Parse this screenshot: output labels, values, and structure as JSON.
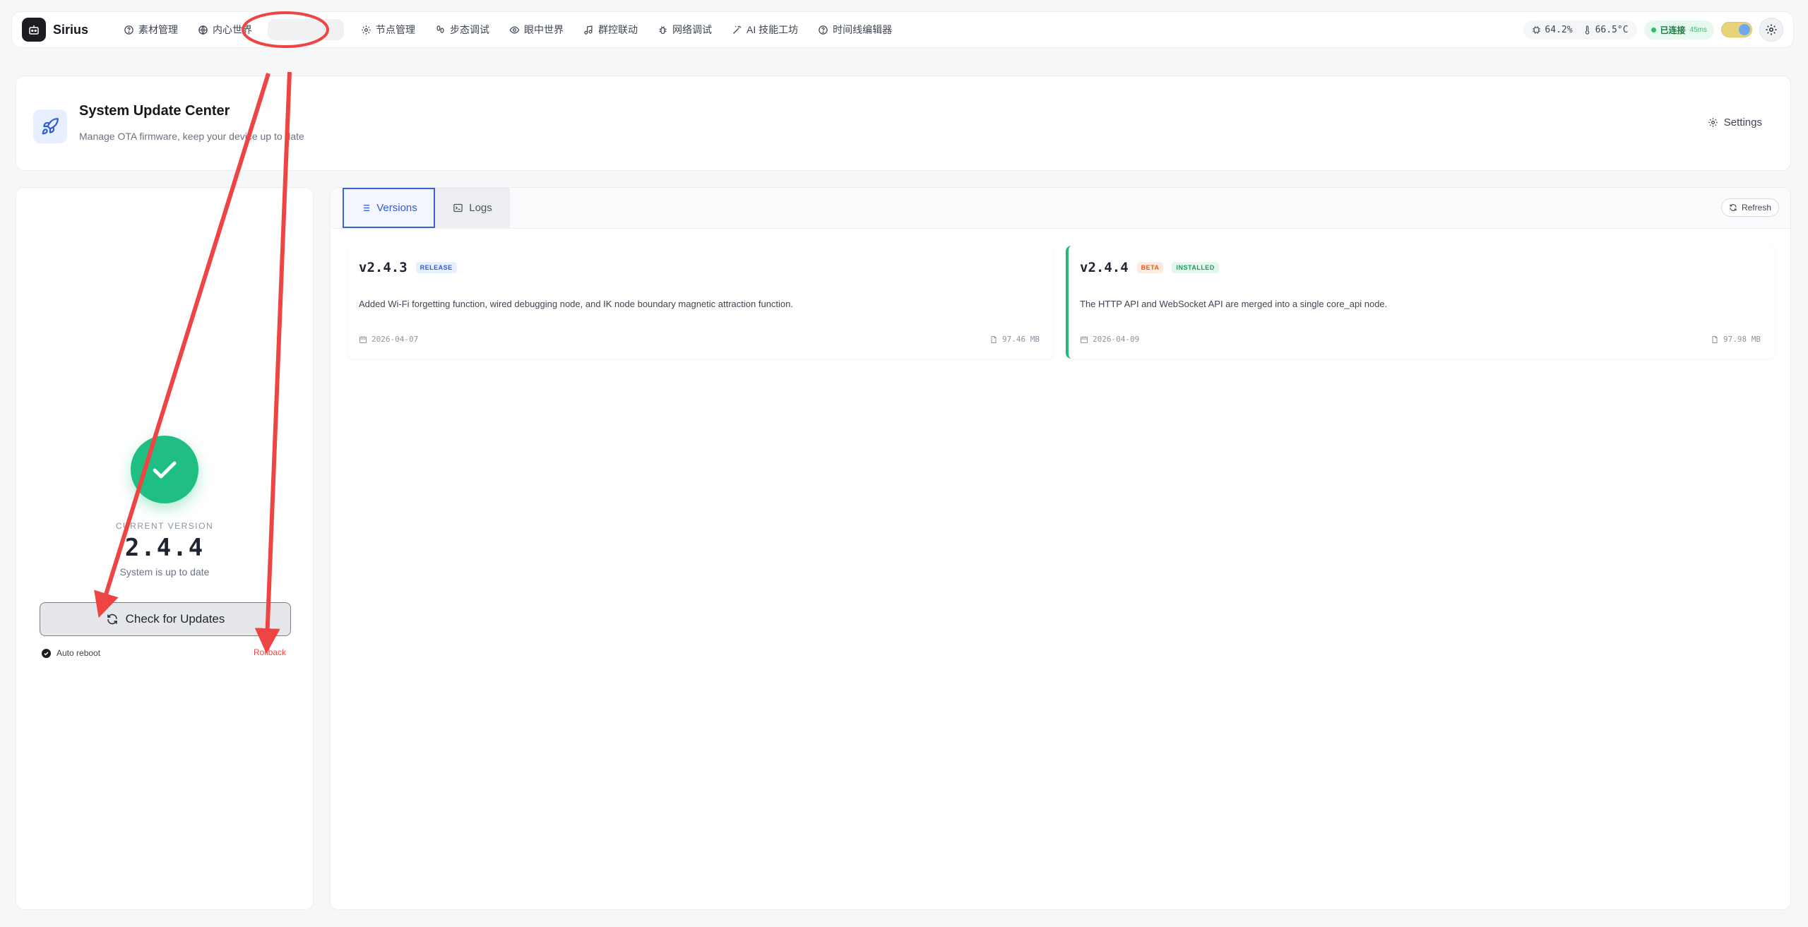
{
  "brand": {
    "name": "Sirius"
  },
  "nav": {
    "items": [
      {
        "label": "素材管理",
        "icon": "help-circle-icon"
      },
      {
        "label": "内心世界",
        "icon": "globe-icon"
      },
      {
        "label": "",
        "icon": ""
      },
      {
        "label": "节点管理",
        "icon": "gear-icon"
      },
      {
        "label": "步态调试",
        "icon": "footprints-icon"
      },
      {
        "label": "眼中世界",
        "icon": "eye-icon"
      },
      {
        "label": "群控联动",
        "icon": "music-note-icon"
      },
      {
        "label": "网络调试",
        "icon": "bug-icon"
      },
      {
        "label": "AI 技能工坊",
        "icon": "magic-wand-icon"
      },
      {
        "label": "时间线编辑器",
        "icon": "help-circle-icon"
      }
    ]
  },
  "status": {
    "cpu": "64.2%",
    "temp": "66.5°C",
    "connection": "已连接",
    "latency": "45ms"
  },
  "header": {
    "title": "System Update Center",
    "subtitle": "Manage OTA firmware, keep your device up to date",
    "settings_label": "Settings"
  },
  "current": {
    "label": "CURRENT VERSION",
    "version": "2.4.4",
    "status": "System is up to date",
    "check_button": "Check for Updates",
    "auto_reboot": "Auto reboot",
    "rollback": "Rollback"
  },
  "tabs": {
    "versions": "Versions",
    "logs": "Logs",
    "refresh": "Refresh"
  },
  "versions": [
    {
      "version": "v2.4.3",
      "badges": [
        "RELEASE"
      ],
      "description": "Added Wi-Fi forgetting function, wired debugging node, and IK node boundary magnetic attraction function.",
      "date": "2026-04-07",
      "size": "97.46 MB"
    },
    {
      "version": "v2.4.4",
      "badges": [
        "BETA",
        "INSTALLED"
      ],
      "description": "The HTTP API and WebSocket API are merged into a single core_api node.",
      "date": "2026-04-09",
      "size": "97.98 MB"
    }
  ],
  "colors": {
    "accent": "#2f5bd3",
    "success": "#1fbf83",
    "annotation": "#ef4444"
  }
}
